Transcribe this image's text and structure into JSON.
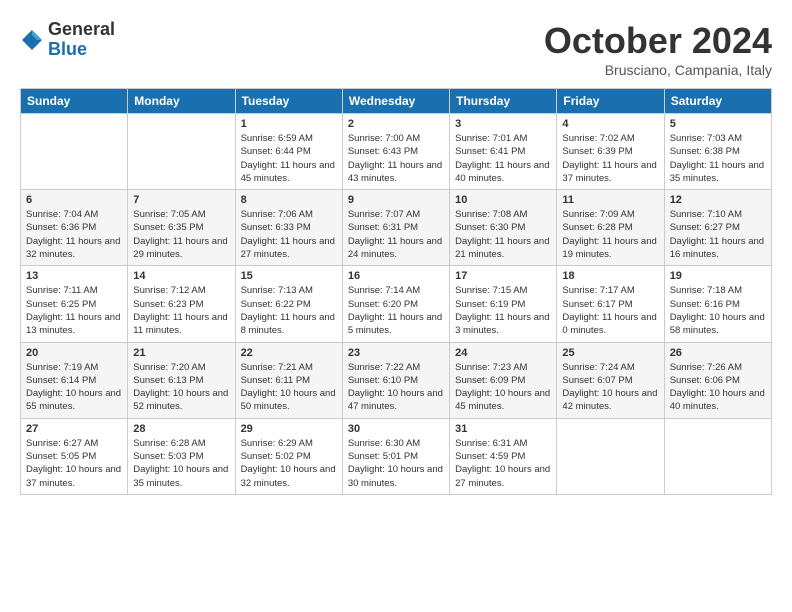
{
  "logo": {
    "general": "General",
    "blue": "Blue"
  },
  "title": "October 2024",
  "subtitle": "Brusciano, Campania, Italy",
  "days_of_week": [
    "Sunday",
    "Monday",
    "Tuesday",
    "Wednesday",
    "Thursday",
    "Friday",
    "Saturday"
  ],
  "weeks": [
    [
      {
        "num": "",
        "detail": ""
      },
      {
        "num": "",
        "detail": ""
      },
      {
        "num": "1",
        "detail": "Sunrise: 6:59 AM\nSunset: 6:44 PM\nDaylight: 11 hours and 45 minutes."
      },
      {
        "num": "2",
        "detail": "Sunrise: 7:00 AM\nSunset: 6:43 PM\nDaylight: 11 hours and 43 minutes."
      },
      {
        "num": "3",
        "detail": "Sunrise: 7:01 AM\nSunset: 6:41 PM\nDaylight: 11 hours and 40 minutes."
      },
      {
        "num": "4",
        "detail": "Sunrise: 7:02 AM\nSunset: 6:39 PM\nDaylight: 11 hours and 37 minutes."
      },
      {
        "num": "5",
        "detail": "Sunrise: 7:03 AM\nSunset: 6:38 PM\nDaylight: 11 hours and 35 minutes."
      }
    ],
    [
      {
        "num": "6",
        "detail": "Sunrise: 7:04 AM\nSunset: 6:36 PM\nDaylight: 11 hours and 32 minutes."
      },
      {
        "num": "7",
        "detail": "Sunrise: 7:05 AM\nSunset: 6:35 PM\nDaylight: 11 hours and 29 minutes."
      },
      {
        "num": "8",
        "detail": "Sunrise: 7:06 AM\nSunset: 6:33 PM\nDaylight: 11 hours and 27 minutes."
      },
      {
        "num": "9",
        "detail": "Sunrise: 7:07 AM\nSunset: 6:31 PM\nDaylight: 11 hours and 24 minutes."
      },
      {
        "num": "10",
        "detail": "Sunrise: 7:08 AM\nSunset: 6:30 PM\nDaylight: 11 hours and 21 minutes."
      },
      {
        "num": "11",
        "detail": "Sunrise: 7:09 AM\nSunset: 6:28 PM\nDaylight: 11 hours and 19 minutes."
      },
      {
        "num": "12",
        "detail": "Sunrise: 7:10 AM\nSunset: 6:27 PM\nDaylight: 11 hours and 16 minutes."
      }
    ],
    [
      {
        "num": "13",
        "detail": "Sunrise: 7:11 AM\nSunset: 6:25 PM\nDaylight: 11 hours and 13 minutes."
      },
      {
        "num": "14",
        "detail": "Sunrise: 7:12 AM\nSunset: 6:23 PM\nDaylight: 11 hours and 11 minutes."
      },
      {
        "num": "15",
        "detail": "Sunrise: 7:13 AM\nSunset: 6:22 PM\nDaylight: 11 hours and 8 minutes."
      },
      {
        "num": "16",
        "detail": "Sunrise: 7:14 AM\nSunset: 6:20 PM\nDaylight: 11 hours and 5 minutes."
      },
      {
        "num": "17",
        "detail": "Sunrise: 7:15 AM\nSunset: 6:19 PM\nDaylight: 11 hours and 3 minutes."
      },
      {
        "num": "18",
        "detail": "Sunrise: 7:17 AM\nSunset: 6:17 PM\nDaylight: 11 hours and 0 minutes."
      },
      {
        "num": "19",
        "detail": "Sunrise: 7:18 AM\nSunset: 6:16 PM\nDaylight: 10 hours and 58 minutes."
      }
    ],
    [
      {
        "num": "20",
        "detail": "Sunrise: 7:19 AM\nSunset: 6:14 PM\nDaylight: 10 hours and 55 minutes."
      },
      {
        "num": "21",
        "detail": "Sunrise: 7:20 AM\nSunset: 6:13 PM\nDaylight: 10 hours and 52 minutes."
      },
      {
        "num": "22",
        "detail": "Sunrise: 7:21 AM\nSunset: 6:11 PM\nDaylight: 10 hours and 50 minutes."
      },
      {
        "num": "23",
        "detail": "Sunrise: 7:22 AM\nSunset: 6:10 PM\nDaylight: 10 hours and 47 minutes."
      },
      {
        "num": "24",
        "detail": "Sunrise: 7:23 AM\nSunset: 6:09 PM\nDaylight: 10 hours and 45 minutes."
      },
      {
        "num": "25",
        "detail": "Sunrise: 7:24 AM\nSunset: 6:07 PM\nDaylight: 10 hours and 42 minutes."
      },
      {
        "num": "26",
        "detail": "Sunrise: 7:26 AM\nSunset: 6:06 PM\nDaylight: 10 hours and 40 minutes."
      }
    ],
    [
      {
        "num": "27",
        "detail": "Sunrise: 6:27 AM\nSunset: 5:05 PM\nDaylight: 10 hours and 37 minutes."
      },
      {
        "num": "28",
        "detail": "Sunrise: 6:28 AM\nSunset: 5:03 PM\nDaylight: 10 hours and 35 minutes."
      },
      {
        "num": "29",
        "detail": "Sunrise: 6:29 AM\nSunset: 5:02 PM\nDaylight: 10 hours and 32 minutes."
      },
      {
        "num": "30",
        "detail": "Sunrise: 6:30 AM\nSunset: 5:01 PM\nDaylight: 10 hours and 30 minutes."
      },
      {
        "num": "31",
        "detail": "Sunrise: 6:31 AM\nSunset: 4:59 PM\nDaylight: 10 hours and 27 minutes."
      },
      {
        "num": "",
        "detail": ""
      },
      {
        "num": "",
        "detail": ""
      }
    ]
  ]
}
